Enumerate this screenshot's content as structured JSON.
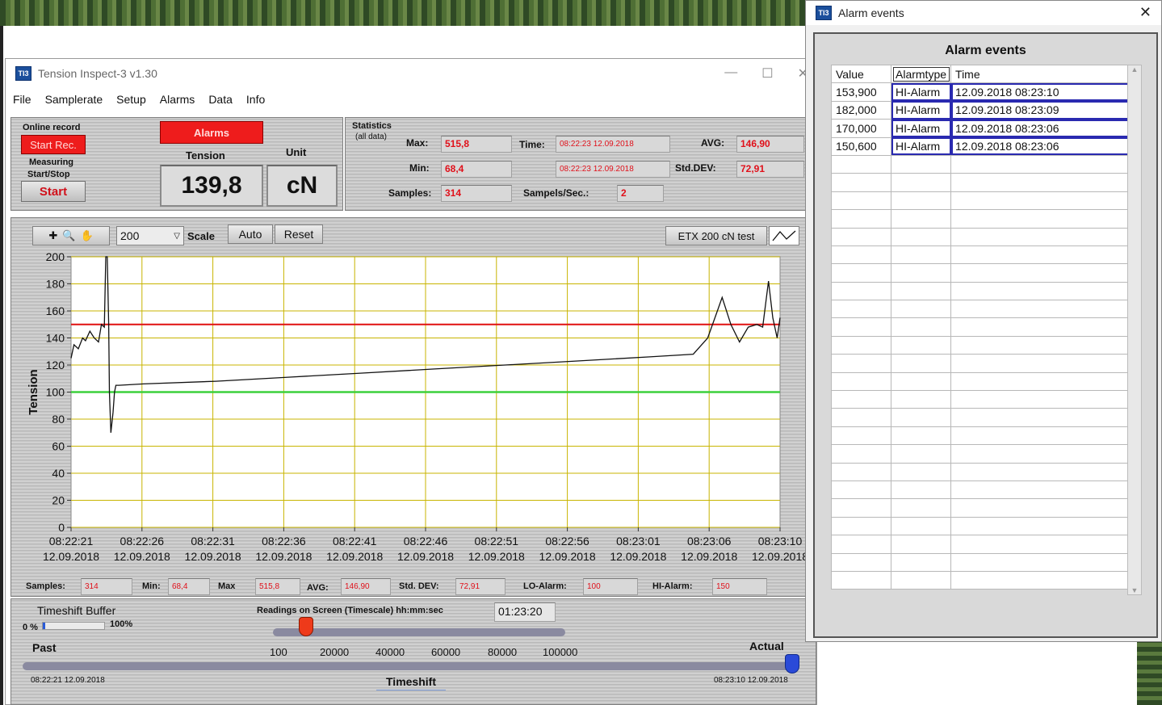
{
  "main": {
    "title": "Tension Inspect-3   v1.30",
    "menu": [
      "File",
      "Samplerate",
      "Setup",
      "Alarms",
      "Data",
      "Info"
    ],
    "online_record": "Online record",
    "start_rec": "Start Rec.",
    "measuring": "Measuring",
    "start_stop": "Start/Stop",
    "start": "Start",
    "alarms_btn": "Alarms",
    "tension_label": "Tension",
    "unit_label": "Unit",
    "tension_value": "139,8",
    "unit_value": "cN",
    "stats": {
      "title": "Statistics",
      "subtitle": "(all data)",
      "max_label": "Max:",
      "max": "515,8",
      "min_label": "Min:",
      "min": "68,4",
      "samples_label": "Samples:",
      "samples": "314",
      "time_label": "Time:",
      "time_max": "08:22:23 12.09.2018",
      "time_min": "08:22:23 12.09.2018",
      "sps_label": "Sampels/Sec.:",
      "sps": "2",
      "avg_label": "AVG:",
      "avg": "146,90",
      "std_label": "Std.DEV:",
      "std": "72,91"
    },
    "toolbar": {
      "scale_value": "200",
      "scale_label": "Scale",
      "auto": "Auto",
      "reset": "Reset",
      "plot_name": "ETX 200 cN test"
    },
    "bottom": {
      "samples_label": "Samples:",
      "samples": "314",
      "min_label": "Min:",
      "min": "68,4",
      "max_label": "Max",
      "max": "515,8",
      "avg_label": "AVG:",
      "avg": "146,90",
      "std_label": "Std. DEV:",
      "std": "72,91",
      "lo_label": "LO-Alarm:",
      "lo": "100",
      "hi_label": "HI-Alarm:",
      "hi": "150"
    },
    "timeshift": {
      "buffer_label": "Timeshift Buffer",
      "pct0": "0 %",
      "pct100": "100%",
      "readings_label": "Readings on Screen (Timescale) hh:mm:sec",
      "readings_value": "01:23:20",
      "ticks": [
        "100",
        "20000",
        "40000",
        "60000",
        "80000",
        "100000"
      ],
      "past": "Past",
      "actual": "Actual",
      "start_time": "08:22:21 12.09.2018",
      "end_time": "08:23:10 12.09.2018",
      "timeshift_label": "Timeshift"
    }
  },
  "chart_data": {
    "type": "line",
    "ylabel": "Tension",
    "ylim": [
      0,
      200
    ],
    "yticks": [
      "0",
      "20",
      "40",
      "60",
      "80",
      "100",
      "120",
      "140",
      "160",
      "180",
      "200"
    ],
    "xticks": [
      [
        "08:22:21",
        "12.09.2018"
      ],
      [
        "08:22:26",
        "12.09.2018"
      ],
      [
        "08:22:31",
        "12.09.2018"
      ],
      [
        "08:22:36",
        "12.09.2018"
      ],
      [
        "08:22:41",
        "12.09.2018"
      ],
      [
        "08:22:46",
        "12.09.2018"
      ],
      [
        "08:22:51",
        "12.09.2018"
      ],
      [
        "08:22:56",
        "12.09.2018"
      ],
      [
        "08:23:01",
        "12.09.2018"
      ],
      [
        "08:23:06",
        "12.09.2018"
      ],
      [
        "08:23:10",
        "12.09.2018"
      ]
    ],
    "hi_alarm": 150,
    "lo_alarm": 100,
    "series": [
      {
        "x": [
          0,
          0.2,
          0.5,
          0.8,
          1.0,
          1.3,
          1.6,
          1.9,
          2.1,
          2.3,
          2.4,
          2.5,
          2.6,
          2.65,
          2.75,
          2.9,
          3.0,
          3.1,
          3.3,
          5,
          10,
          15,
          20,
          25,
          30,
          35,
          40,
          43,
          44,
          44.5,
          45.0,
          45.6,
          46.2,
          46.8,
          47.4,
          47.8,
          48.0,
          48.2,
          48.5,
          48.8,
          49.0
        ],
        "y": [
          125,
          135,
          132,
          140,
          138,
          145,
          140,
          137,
          150,
          148,
          200,
          200,
          150,
          100,
          70,
          85,
          100,
          105,
          105,
          106,
          108,
          111,
          114,
          117,
          120,
          123,
          126,
          128,
          140,
          155,
          170,
          150,
          137,
          148,
          150,
          148,
          165,
          182,
          155,
          140,
          155
        ]
      }
    ]
  },
  "alarm_window": {
    "title": "Alarm events",
    "heading": "Alarm events",
    "columns": [
      "Value",
      "Alarmtype",
      "Time"
    ],
    "rows": [
      [
        "153,900",
        "HI-Alarm",
        "12.09.2018 08:23:10"
      ],
      [
        "182,000",
        "HI-Alarm",
        "12.09.2018 08:23:09"
      ],
      [
        "170,000",
        "HI-Alarm",
        "12.09.2018 08:23:06"
      ],
      [
        "150,600",
        "HI-Alarm",
        "12.09.2018 08:23:06"
      ]
    ]
  },
  "colors": {
    "hi_line": "#e01010",
    "lo_line": "#3cd03c",
    "grid": "#c8b400",
    "alarm_red": "#ee1c1c"
  }
}
